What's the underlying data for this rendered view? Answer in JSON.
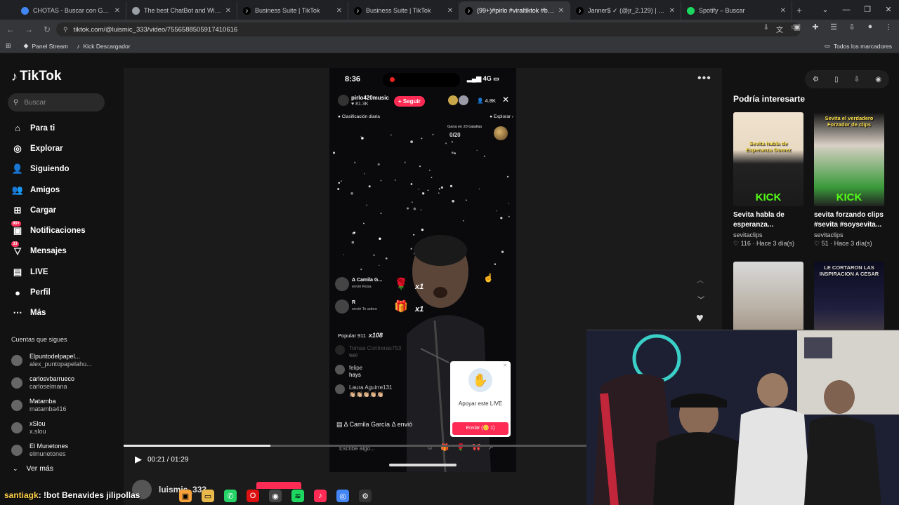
{
  "browser": {
    "tabs": [
      {
        "label": "CHOTAS - Buscar con Google",
        "icon": "google-icon",
        "color": "#4285f4",
        "active": false
      },
      {
        "label": "The best ChatBot and Widgets",
        "icon": "chatbot-icon",
        "color": "#9aa0a6",
        "active": false
      },
      {
        "label": "Business Suite | TikTok",
        "icon": "tiktok-icon",
        "color": "#ffffff",
        "active": false
      },
      {
        "label": "Business Suite | TikTok",
        "icon": "tiktok-icon",
        "color": "#ffffff",
        "active": false
      },
      {
        "label": "(99+)#pirlo #viraltiktok #bless",
        "icon": "tiktok-icon",
        "color": "#ffffff",
        "active": true
      },
      {
        "label": "Janner$ ✓ (@jr_2.129) | TikTok",
        "icon": "tiktok-icon",
        "color": "#ffffff",
        "active": false
      },
      {
        "label": "Spotify – Buscar",
        "icon": "spotify-icon",
        "color": "#1ed760",
        "active": false
      }
    ],
    "url": "tiktok.com/@luismic_333/video/7556588505917410616",
    "bookmarks": [
      {
        "label": "Panel Stream",
        "icon": "diamond-icon"
      },
      {
        "label": "Kick Descargador",
        "icon": "tiktok-icon"
      }
    ],
    "all_bookmarks": "Todos los marcadores"
  },
  "sidebar": {
    "logo": "TikTok",
    "search_placeholder": "Buscar",
    "nav": [
      {
        "label": "Para ti",
        "icon": "home-icon",
        "glyph": "⌂"
      },
      {
        "label": "Explorar",
        "icon": "compass-icon",
        "glyph": "◎"
      },
      {
        "label": "Siguiendo",
        "icon": "following-icon",
        "glyph": "👤"
      },
      {
        "label": "Amigos",
        "icon": "friends-icon",
        "glyph": "👥"
      },
      {
        "label": "Cargar",
        "icon": "upload-icon",
        "glyph": "⊞"
      },
      {
        "label": "Notificaciones",
        "icon": "inbox-icon",
        "glyph": "▣",
        "badge": "99+"
      },
      {
        "label": "Mensajes",
        "icon": "messages-icon",
        "glyph": "▽",
        "badge": "33"
      },
      {
        "label": "LIVE",
        "icon": "live-icon",
        "glyph": "▤"
      },
      {
        "label": "Perfil",
        "icon": "profile-icon",
        "glyph": "●"
      },
      {
        "label": "Más",
        "icon": "more-icon",
        "glyph": "⋯"
      }
    ],
    "following_title": "Cuentas que sigues",
    "following": [
      {
        "name": "Elpuntodelpapel...",
        "handle": "alex_puntopapelahu..."
      },
      {
        "name": "carlosvbarrueco",
        "handle": "carloselmana"
      },
      {
        "name": "Matamba",
        "handle": "matamba416"
      },
      {
        "name": "xSlou",
        "handle": "x.slou"
      },
      {
        "name": "El Munetones",
        "handle": "elmunetones"
      }
    ],
    "see_more": "Ver más"
  },
  "live": {
    "time": "8:36",
    "network": "4G",
    "host": "pirlo420music",
    "host_views": "81.3K",
    "follow": "+ Seguir",
    "viewers": "4.8K",
    "ranking": "Clasificación diaria",
    "explore": "Explorar",
    "battle_label": "Gana en 20 batallas",
    "battle_value": "0/20",
    "gifts": [
      {
        "name": "Δ Camila G...",
        "sub": "envió Rosa",
        "icon": "🌹",
        "count": "x1"
      },
      {
        "name": "R",
        "sub": "envió Te adoro",
        "icon": "🎁",
        "count": "x1"
      }
    ],
    "popular_label": "Popular 911",
    "popular_mult": "x108",
    "comments": [
      {
        "name": "Tomas Contreras753",
        "text": "wel",
        "faded": true
      },
      {
        "name": "felipe",
        "text": "hays",
        "faded": false
      },
      {
        "name": "Laura Aguirre131",
        "text": "👏🏼👏🏼👏🏼👏🏼👏🏼",
        "faded": false
      }
    ],
    "join_text": "Δ Camila García Δ envió",
    "support_text": "Apoyar este LIVE",
    "support_button": "Enviar (🪙 1)",
    "composer_placeholder": "Escribe algo...",
    "progress": 0.245,
    "time_display": "00:21 / 01:29"
  },
  "author": {
    "name": "luismic_333"
  },
  "recommendations": {
    "title": "Podría interesarte",
    "cards": [
      {
        "title": "Sevita habla de esperanza...",
        "author": "sevitaclips",
        "likes": "116",
        "age": "Hace 3 día(s)",
        "thumb_caption": "Sevita habla de Esperanza Gomez",
        "thumb_badge": "KICK"
      },
      {
        "title": "sevita forzando clips #sevita #soysevita...",
        "author": "sevitaclips",
        "likes": "51",
        "age": "Hace 3 día(s)",
        "thumb_caption": "Sevita el verdadero Forzador de clips",
        "thumb_badge": "KICK"
      },
      {
        "title": "",
        "author": "",
        "likes": "",
        "age": "",
        "thumb_caption": "",
        "thumb_badge": ""
      },
      {
        "title": "",
        "author": "",
        "likes": "",
        "age": "",
        "thumb_caption": "LE CORTARON LAS INSPIRACION A CESAR",
        "thumb_badge": ""
      }
    ]
  },
  "stream_overlay": {
    "chat_user": "santiagk",
    "chat_text": ": !bot Benavides jilipollas"
  },
  "colors": {
    "accent": "#fe2c55",
    "background": "#121212"
  }
}
